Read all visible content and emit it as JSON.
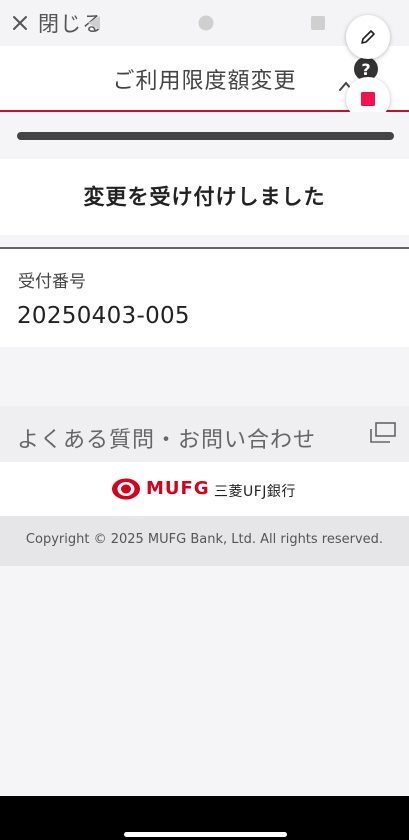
{
  "topbar": {
    "close_label": "閉じる"
  },
  "header": {
    "title": "ご利用限度額変更"
  },
  "status": {
    "message": "変更を受け付けしました"
  },
  "receipt": {
    "label": "受付番号",
    "number": "20250403-005"
  },
  "faq": {
    "label": "よくある質問・お問い合わせ"
  },
  "footer": {
    "logo_text": "MUFG",
    "bank_name": "三菱UFJ銀行",
    "copyright": "Copyright © 2025 MUFG Bank, Ltd. All rights reserved."
  },
  "colors": {
    "brand_red": "#d6001c",
    "accent_red": "#c8102e"
  },
  "icons": {
    "close": "close-icon",
    "help": "help-icon",
    "edit": "pencil-icon",
    "stop": "stop-icon",
    "faq_external": "external-link-icon",
    "nav_back": "back-triangle-icon",
    "nav_home": "home-circle-icon",
    "nav_recents": "recents-square-icon"
  }
}
